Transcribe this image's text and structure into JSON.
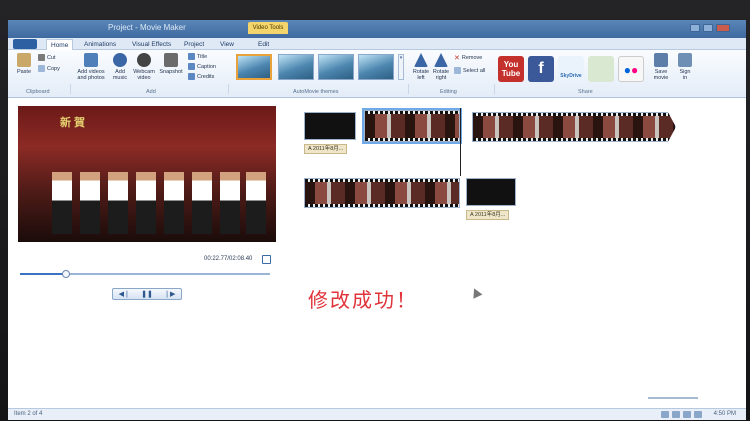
{
  "window": {
    "title": "Project - Movie Maker",
    "context_tab": "Video Tools"
  },
  "tabs": [
    "Home",
    "Animations",
    "Visual Effects",
    "Project",
    "View",
    "Edit"
  ],
  "ribbon": {
    "clipboard": {
      "paste": "Paste",
      "cut": "Cut",
      "copy": "Copy",
      "label": "Clipboard"
    },
    "add": {
      "add_videos_l1": "Add videos",
      "add_videos_l2": "and photos",
      "add_music_l1": "Add",
      "add_music_l2": "music",
      "webcam_l1": "Webcam",
      "webcam_l2": "video",
      "snapshot": "Snapshot",
      "title": "Title",
      "caption": "Caption",
      "credits": "Credits",
      "label": "Add"
    },
    "themes": {
      "label": "AutoMovie themes"
    },
    "editing": {
      "rotate_left_l1": "Rotate",
      "rotate_left_l2": "left",
      "rotate_right_l1": "Rotate",
      "rotate_right_l2": "right",
      "remove": "Remove",
      "select_all": "Select all",
      "label": "Editing"
    },
    "share": {
      "youtube_l1": "You",
      "youtube_l2": "Tube",
      "facebook": "f",
      "skydrive": "SkyDrive",
      "save_movie_l1": "Save",
      "save_movie_l2": "movie",
      "sign_in_l1": "Sign",
      "sign_in_l2": "in",
      "label": "Share"
    }
  },
  "player": {
    "timecode": "00:22.77/02:08.40",
    "overlay_text": "新 賀"
  },
  "timeline": {
    "caption_1": "A 2011年8月...",
    "caption_2": "A 2011年8月..."
  },
  "overlay_message": "修改成功！",
  "status": {
    "text": "Item 2 of 4",
    "clock": "4:50 PM"
  },
  "colors": {
    "accent": "#3b73c4",
    "success_text": "#e0333a",
    "ribbon_border": "#b0c4de"
  }
}
